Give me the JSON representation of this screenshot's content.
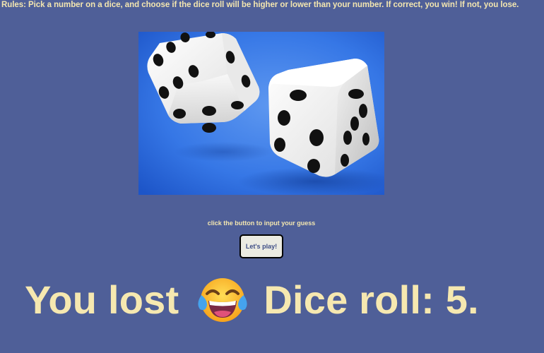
{
  "rules_text": "Rules: Pick a number on a dice, and choose if the dice roll will be higher or lower than your number. If correct, you win! If not, you lose.",
  "image": {
    "subject": "two white dice against a blue background"
  },
  "prompt_text": "click the button to input your guess",
  "play_button_label": "Let's play!",
  "result": {
    "lead": "You lost",
    "emoji_icon": "face-with-tears-of-joy-icon",
    "dice_roll_text": "Dice roll: 5."
  },
  "colors": {
    "background": "#4f5f98",
    "text": "#f3e6b0",
    "button_background": "#ebebe2",
    "button_text": "#3d4d86",
    "image_background": "#2f6fe0"
  }
}
